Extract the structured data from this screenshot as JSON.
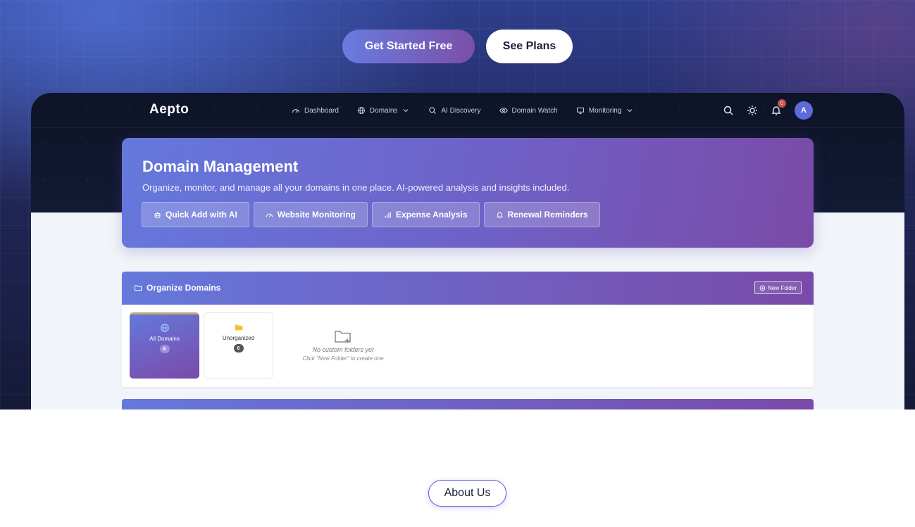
{
  "hero": {
    "primary_cta": "Get Started Free",
    "secondary_cta": "See Plans"
  },
  "app": {
    "logo": "Aepto",
    "nav": [
      {
        "label": "Dashboard",
        "icon": "gauge-icon"
      },
      {
        "label": "Domains",
        "icon": "globe-icon",
        "dropdown": true
      },
      {
        "label": "AI Discovery",
        "icon": "search-icon"
      },
      {
        "label": "Domain Watch",
        "icon": "eye-icon"
      },
      {
        "label": "Monitoring",
        "icon": "monitor-icon",
        "dropdown": true
      }
    ],
    "notification_count": "0",
    "avatar_initial": "A"
  },
  "domain_management": {
    "title": "Domain Management",
    "subtitle": "Organize, monitor, and manage all your domains in one place. AI-powered analysis and insights included.",
    "actions": [
      {
        "label": "Quick Add with AI",
        "icon": "robot-icon"
      },
      {
        "label": "Website Monitoring",
        "icon": "gauge-icon"
      },
      {
        "label": "Expense Analysis",
        "icon": "bar-chart-icon"
      },
      {
        "label": "Renewal Reminders",
        "icon": "bell-icon"
      }
    ]
  },
  "organize": {
    "title": "Organize Domains",
    "new_folder": "New Folder",
    "folders": [
      {
        "label": "All Domains",
        "count": "6",
        "icon": "globe-icon",
        "active": true
      },
      {
        "label": "Unorganized",
        "count": "6",
        "icon": "folder-icon",
        "active": false
      }
    ],
    "empty_title": "No custom folders yet",
    "empty_hint": "Click \"New Folder\" to create one"
  },
  "footer": {
    "about": "About Us"
  },
  "colors": {
    "accent_start": "#6578dc",
    "accent_end": "#7a4aa8",
    "folder_yellow": "#f2c230"
  }
}
